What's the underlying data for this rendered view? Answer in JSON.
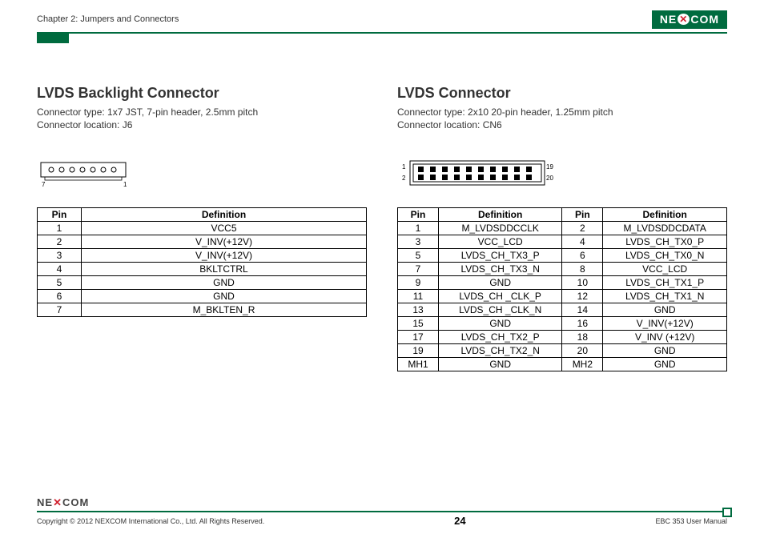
{
  "header": {
    "chapter": "Chapter 2: Jumpers and Connectors",
    "brand": "NEXCOM"
  },
  "left": {
    "title": "LVDS Backlight Connector",
    "type_line": "Connector type: 1x7 JST, 7-pin header, 2.5mm pitch",
    "loc_line": "Connector location: J6",
    "diagram_labels": {
      "left": "7",
      "right": "1"
    },
    "table": {
      "headers": [
        "Pin",
        "Definition"
      ],
      "rows": [
        [
          "1",
          "VCC5"
        ],
        [
          "2",
          "V_INV(+12V)"
        ],
        [
          "3",
          "V_INV(+12V)"
        ],
        [
          "4",
          "BKLTCTRL"
        ],
        [
          "5",
          "GND"
        ],
        [
          "6",
          "GND"
        ],
        [
          "7",
          "M_BKLTEN_R"
        ]
      ]
    }
  },
  "right": {
    "title": "LVDS Connector",
    "type_line": "Connector type: 2x10 20-pin header, 1.25mm pitch",
    "loc_line": "Connector location: CN6",
    "diagram_labels": {
      "tl": "1",
      "bl": "2",
      "tr": "19",
      "br": "20"
    },
    "table": {
      "headers": [
        "Pin",
        "Definition",
        "Pin",
        "Definition"
      ],
      "rows": [
        [
          "1",
          "M_LVDSDDCCLK",
          "2",
          "M_LVDSDDCDATA"
        ],
        [
          "3",
          "VCC_LCD",
          "4",
          "LVDS_CH_TX0_P"
        ],
        [
          "5",
          "LVDS_CH_TX3_P",
          "6",
          "LVDS_CH_TX0_N"
        ],
        [
          "7",
          "LVDS_CH_TX3_N",
          "8",
          "VCC_LCD"
        ],
        [
          "9",
          "GND",
          "10",
          "LVDS_CH_TX1_P"
        ],
        [
          "11",
          "LVDS_CH _CLK_P",
          "12",
          "LVDS_CH_TX1_N"
        ],
        [
          "13",
          "LVDS_CH _CLK_N",
          "14",
          "GND"
        ],
        [
          "15",
          "GND",
          "16",
          "V_INV(+12V)"
        ],
        [
          "17",
          "LVDS_CH_TX2_P",
          "18",
          "V_INV (+12V)"
        ],
        [
          "19",
          "LVDS_CH_TX2_N",
          "20",
          "GND"
        ],
        [
          "MH1",
          "GND",
          "MH2",
          "GND"
        ]
      ]
    }
  },
  "footer": {
    "brand": "NEXCOM",
    "copyright": "Copyright © 2012 NEXCOM International Co., Ltd. All Rights Reserved.",
    "page": "24",
    "manual": "EBC 353 User Manual"
  }
}
